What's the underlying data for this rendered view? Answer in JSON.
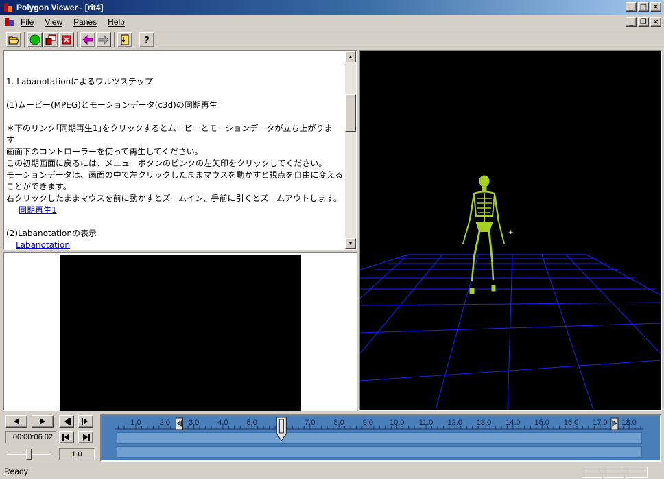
{
  "window": {
    "title": "Polygon Viewer - [rit4]"
  },
  "menu": {
    "items": [
      "File",
      "View",
      "Panes",
      "Help"
    ]
  },
  "toolbar": {
    "buttons": [
      "open-icon",
      "play-green-icon",
      "windows-icon",
      "stop-red-icon",
      "back-magenta-icon",
      "forward-gray-icon",
      "page-arrow-icon",
      "help-icon"
    ]
  },
  "text_pane": {
    "heading": "1.  Labanotationによるワルツステップ",
    "section1": "(1)ムービー(MPEG)とモーションデータ(c3d)の同期再生",
    "note1": "＊下のリンク｢同期再生1｣をクリックするとムービーとモーションデータが立ち上がります。",
    "note2": "画面下のコントローラーを使って再生してください。",
    "note3": "この初期画面に戻るには、メニューボタンのピンクの左矢印をクリックしてください。",
    "note4": "モーションデータは、画面の中で左クリックしたままマウスを動かすと視点を自由に変えることができます。",
    "note5": "右クリックしたままマウスを前に動かすとズームイン、手前に引くとズームアウトします。",
    "link1": "同期再生1",
    "section2": "(2)Labanotationの表示",
    "link2": "Labanotation"
  },
  "controls": {
    "time": "00:00:06.02",
    "speed": "1.0"
  },
  "timeline": {
    "ticks": [
      "1.0",
      "2.0",
      "3.0",
      "4.0",
      "5.0",
      "6.0",
      "7.0",
      "8.0",
      "9.0",
      "10.0",
      "11.0",
      "12.0",
      "13.0",
      "14.0",
      "15.0",
      "16.0",
      "17.0",
      "18.0"
    ],
    "start_marker": 2.5,
    "current": 6.02,
    "end_marker": 17.5
  },
  "colors": {
    "grid": "#2020ff",
    "skeleton": "#a8d020",
    "timeline_bg": "#4a7eb8"
  },
  "status": {
    "text": "Ready"
  }
}
